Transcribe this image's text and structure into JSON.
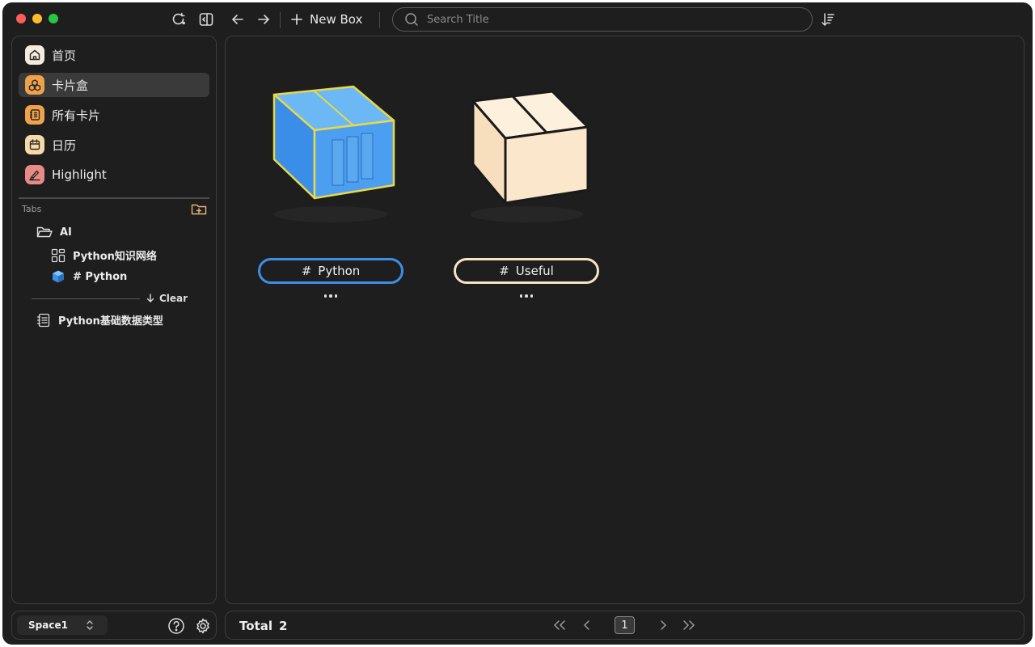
{
  "toolbar": {
    "new_box_label": "New Box",
    "search_placeholder": "Search Title"
  },
  "sidebar": {
    "items": [
      {
        "label": "首页",
        "icon": "home-icon",
        "color": "#f5ece0"
      },
      {
        "label": "卡片盒",
        "icon": "card-box-icon",
        "color": "#f0a24a",
        "active": true
      },
      {
        "label": "所有卡片",
        "icon": "notebook-icon",
        "color": "#f0a24a"
      },
      {
        "label": "日历",
        "icon": "calendar-icon",
        "color": "#f7d9a8"
      },
      {
        "label": "Highlight",
        "icon": "highlighter-icon",
        "color": "#e88b86"
      }
    ],
    "tabs_label": "Tabs",
    "tree": {
      "folder_label": "AI",
      "children": [
        {
          "label": "Python知识网络",
          "icon": "grid-network-icon"
        },
        {
          "label": "# Python",
          "icon": "cube-icon"
        }
      ],
      "clear_label": "Clear",
      "doc_label": "Python基础数据类型"
    }
  },
  "boxes": [
    {
      "label": "Python",
      "hash": "#",
      "border_color": "#3d8fe6"
    },
    {
      "label": "Useful",
      "hash": "#",
      "border_color": "#f7e3c6"
    }
  ],
  "footer": {
    "space_name": "Space1",
    "total_label": "Total",
    "total_value": "2",
    "current_page": "1"
  },
  "colors": {
    "background": "#1e1e1e",
    "border": "#3c3c3c",
    "accent_blue": "#3d8fe6",
    "accent_cream": "#f7e3c6"
  }
}
